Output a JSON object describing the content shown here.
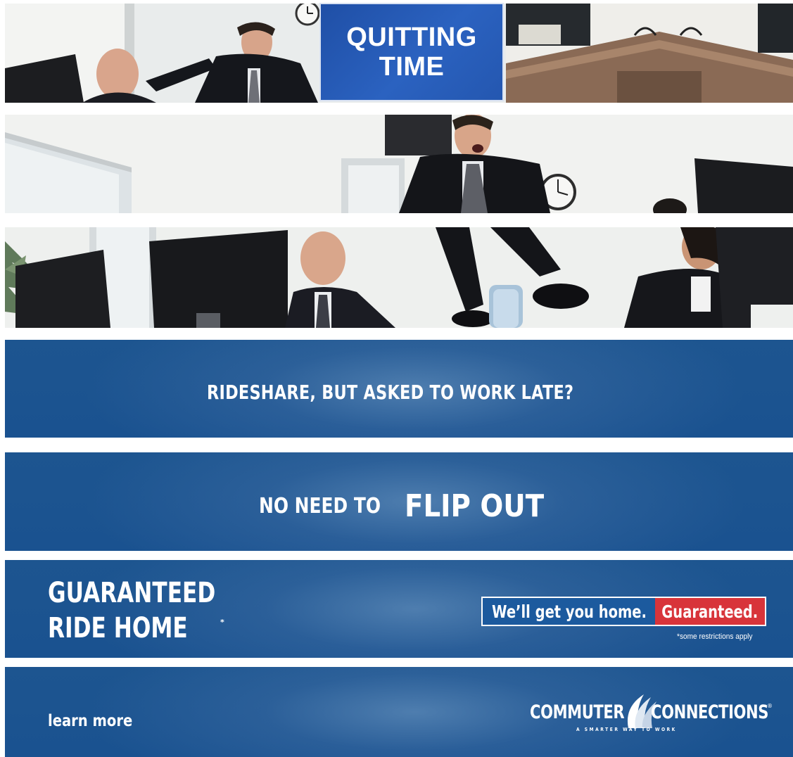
{
  "banner": {
    "title": "QUITTING TIME"
  },
  "band1": {
    "question": "RIDESHARE, BUT ASKED TO WORK LATE?"
  },
  "band2": {
    "lead": "NO NEED TO",
    "emphasis": "FLIP OUT"
  },
  "band3": {
    "program_line1": "GUARANTEED",
    "program_line2": "RIDE HOME",
    "program_mark": "*",
    "guarantee_left": "We’ll get you home.",
    "guarantee_right": "Guaranteed.",
    "restrictions": "*some restrictions apply"
  },
  "band4": {
    "learn_more": "learn more",
    "logo_word1": "COMMUTER",
    "logo_word2": "CONNECTIONS",
    "logo_registered": "®",
    "logo_tagline": "A SMARTER WAY TO WORK"
  },
  "colors": {
    "band_blue": "#1a5290",
    "title_blue": "#2457b0",
    "guarantee_red": "#d8343a"
  }
}
